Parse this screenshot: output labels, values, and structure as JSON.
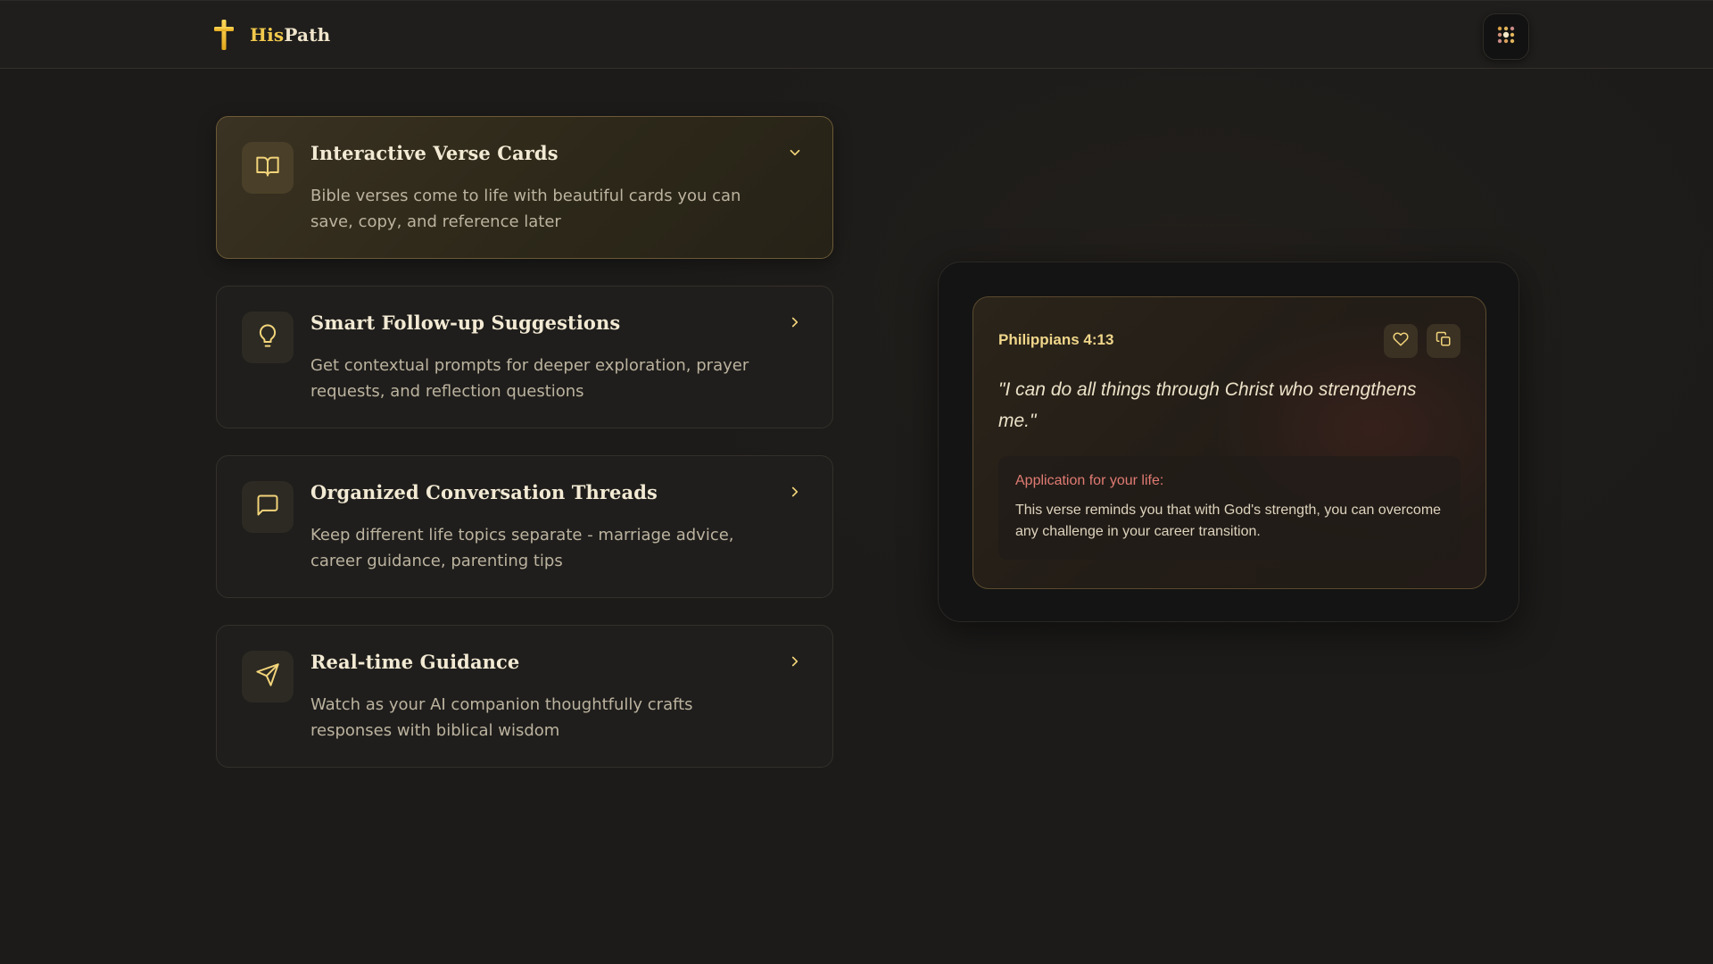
{
  "header": {
    "brand_his": "His",
    "brand_path": "Path",
    "logo_icon": "cross-icon",
    "menu_icon": "dots-grid-icon"
  },
  "features": [
    {
      "title": "Interactive Verse Cards",
      "description": "Bible verses come to life with beautiful cards you can save, copy, and reference later",
      "icon": "book-open-icon",
      "expanded": true
    },
    {
      "title": "Smart Follow-up Suggestions",
      "description": "Get contextual prompts for deeper exploration, prayer requests, and reflection questions",
      "icon": "lightbulb-icon",
      "expanded": false
    },
    {
      "title": "Organized Conversation Threads",
      "description": "Keep different life topics separate - marriage advice, career guidance, parenting tips",
      "icon": "message-square-icon",
      "expanded": false
    },
    {
      "title": "Real-time Guidance",
      "description": "Watch as your AI companion thoughtfully crafts responses with biblical wisdom",
      "icon": "send-icon",
      "expanded": false
    }
  ],
  "verse_card": {
    "reference": "Philippians 4:13",
    "text": "\"I can do all things through Christ who strengthens me.\"",
    "application_label": "Application for your life:",
    "application_text": "This verse reminds you that with God's strength, you can overcome any challenge in your career transition."
  },
  "colors": {
    "accent_gold": "#f2c94c",
    "application_label": "#e07b73",
    "background": "#1c1b1a"
  }
}
